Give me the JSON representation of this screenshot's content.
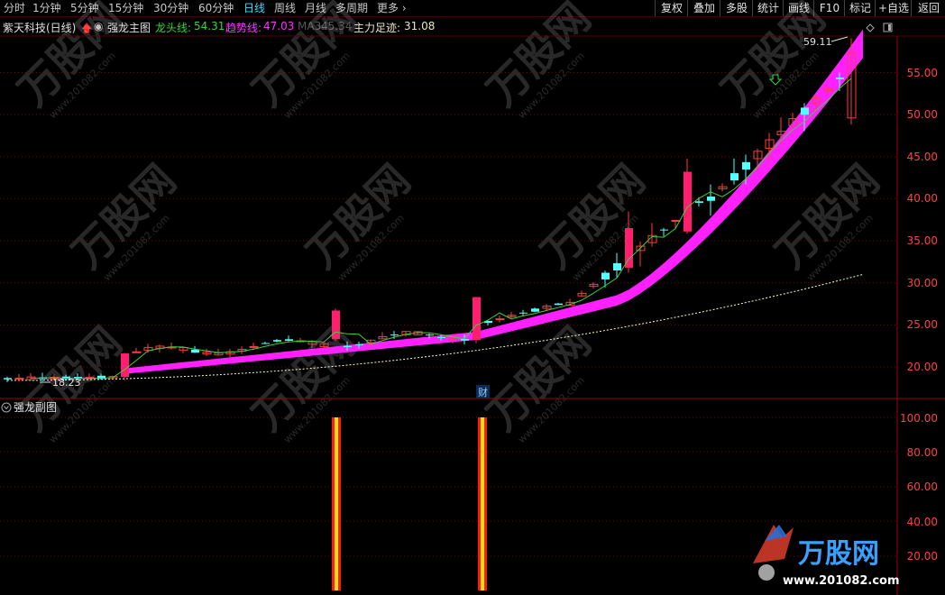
{
  "toolbar": {
    "tabs": [
      "分时",
      "1分钟",
      "5分钟",
      "15分钟",
      "30分钟",
      "60分钟",
      "日线",
      "周线",
      "月线",
      "多周期",
      "更多"
    ],
    "active_tab": "日线",
    "buttons": [
      "复权",
      "叠加",
      "多股",
      "统计",
      "画线",
      "F10",
      "标记",
      "+自选",
      "返回"
    ]
  },
  "info": {
    "stock": "紫天科技(日线)",
    "indicator": "强龙主图",
    "longtou_label": "龙头线:",
    "longtou_value": "54.31",
    "trend_label": "趋势线:",
    "trend_value": "47.03",
    "ma_label": "MA3:",
    "ma_value": "45.34",
    "main_label": "主力足迹:",
    "main_value": "31.08"
  },
  "main_chart": {
    "price_axis": [
      "55.00",
      "50.00",
      "45.00",
      "40.00",
      "35.00",
      "30.00",
      "25.00",
      "20.00"
    ],
    "high_label": "59.11",
    "low_label": "18.23",
    "event_badge": "财",
    "colors": {
      "up": "#ff3b3b",
      "down": "#54ffff",
      "longtou": "#3ad23a",
      "trend": "#ff33ff",
      "main": "#ffffc0"
    }
  },
  "sub_chart": {
    "title": "强龙副图",
    "axis": [
      "100.00",
      "80.00",
      "60.00",
      "40.00",
      "20.00"
    ]
  },
  "watermark": {
    "brand": "万股网",
    "url": "www.201082.com"
  }
}
